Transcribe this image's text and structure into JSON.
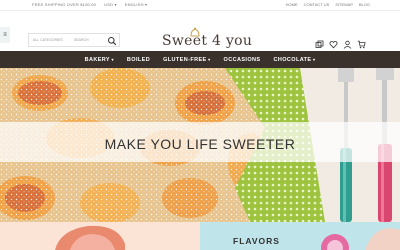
{
  "topbar": {
    "left": [
      "FREE SHIPPING OVER $100.00",
      "USD",
      "ENGLISH"
    ],
    "right": [
      "HOME",
      "CONTACT US",
      "SITEMAP",
      "BLOG"
    ]
  },
  "search": {
    "category": "ALL CATEGORIES",
    "placeholder": "SEARCH"
  },
  "brand": {
    "logo_text": "Sweet 4 you"
  },
  "nav": {
    "items": [
      "BAKERY",
      "BOILED",
      "GLUTEN-FREE",
      "OCCASIONS",
      "CHOCOLATE"
    ]
  },
  "hero": {
    "title": "MAKE YOU LIFE SWEETER"
  },
  "promo": {
    "label": "FLAVORS"
  },
  "colors": {
    "nav_bg": "#3a312d",
    "accent": "#c9a24b"
  }
}
